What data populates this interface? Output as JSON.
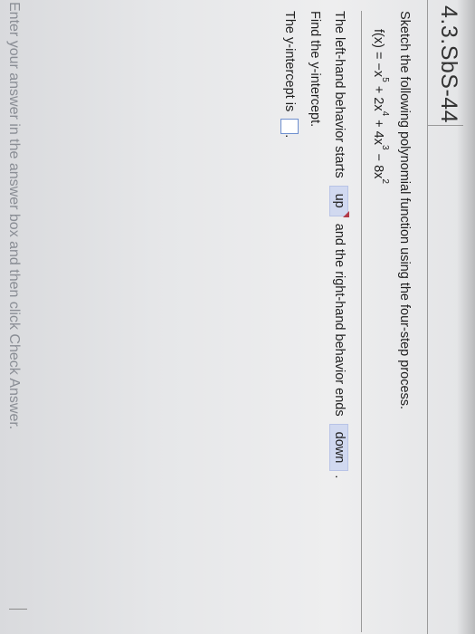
{
  "header": {
    "title": "4.3.SbS-44"
  },
  "question": {
    "prompt": "Sketch the following polynomial function using the four-step process.",
    "function_prefix": "f(x) = −x",
    "exp1": "5",
    "term2": " + 2x",
    "exp2": "4",
    "term3": " + 4x",
    "exp3": "3",
    "term4": " − 8x",
    "exp4": "2"
  },
  "behavior": {
    "left_text": "The left-hand behavior starts",
    "left_value": "up",
    "right_text": "and the right-hand behavior ends",
    "right_value": "down",
    "end_punct": "."
  },
  "intercept": {
    "find_text": "Find the y-intercept.",
    "label": "The y-intercept is",
    "value": "",
    "end_punct": "."
  },
  "footer": {
    "instruction": "Enter your answer in the answer box and then click Check Answer."
  }
}
